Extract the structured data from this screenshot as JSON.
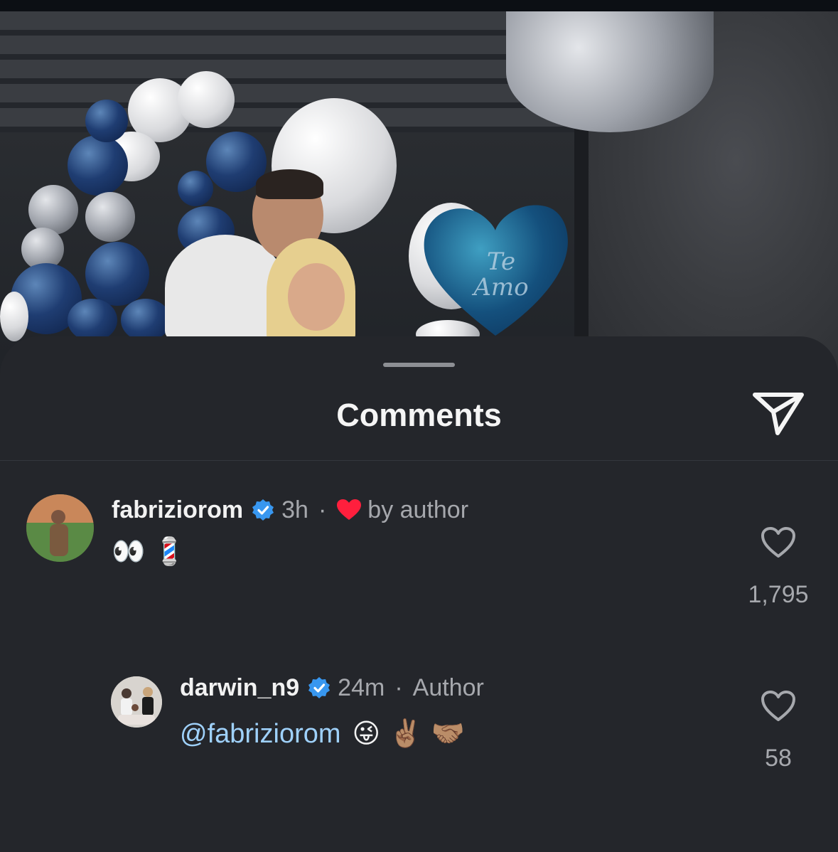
{
  "sheet": {
    "title": "Comments",
    "share_icon": "send-icon"
  },
  "photo": {
    "heart_balloon_text": "Te Amo"
  },
  "comments": [
    {
      "username": "fabriziorom",
      "verified": true,
      "time": "3h",
      "separator": "·",
      "liked_by_author": "by author",
      "text": "👀 💈",
      "likes": "1,795"
    },
    {
      "username": "darwin_n9",
      "verified": true,
      "time": "24m",
      "separator": "·",
      "role": "Author",
      "mention": "@fabriziorom",
      "text": "😜 ✌🏽 🤝🏽",
      "likes": "58"
    }
  ],
  "colors": {
    "sheet_bg": "#24262b",
    "verified": "#3897f0",
    "author_heart": "#ff3040",
    "mention": "#9fd1fb"
  }
}
